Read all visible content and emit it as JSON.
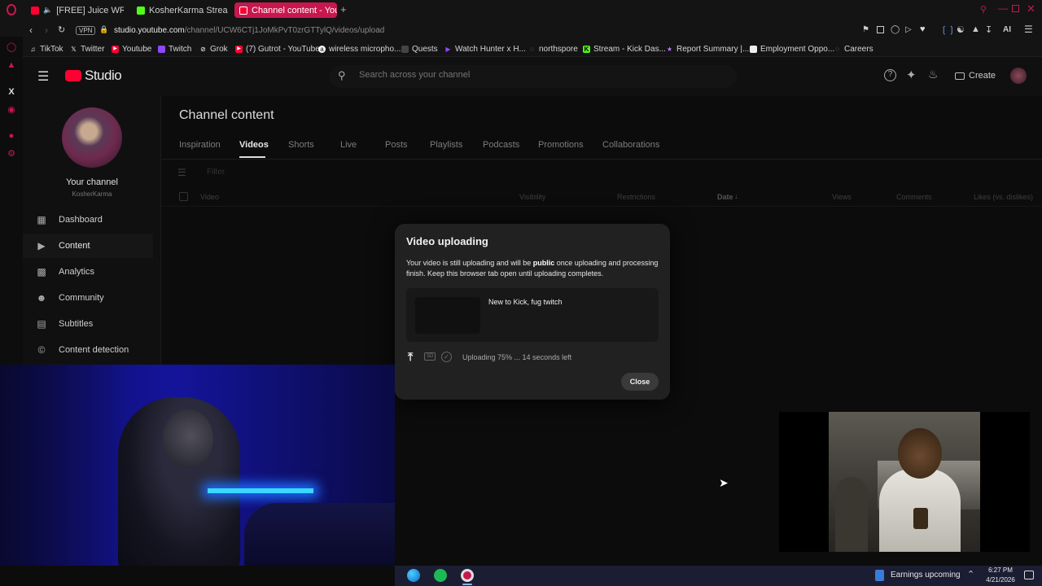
{
  "browser": {
    "tabs": [
      {
        "title": "[FREE] Juice WRLD Ty",
        "color": "#ff0033"
      },
      {
        "title": "KosherKarma Stream - W",
        "color": "#53fc18"
      },
      {
        "title": "Channel content - YouTube",
        "color": "#ff0033",
        "active": true
      }
    ],
    "vpn_label": "VPN",
    "url_domain": "studio.youtube.com",
    "url_path": "/channel/UCW6CTj1JoMkPvT0zrGTTylQ/videos/upload",
    "ai_label": "AI",
    "bookmarks": [
      {
        "label": "TikTok",
        "icon": "tiktok-icon"
      },
      {
        "label": "Twitter",
        "icon": "x-icon"
      },
      {
        "label": "Youtube",
        "icon": "youtube-icon"
      },
      {
        "label": "Twitch",
        "icon": "twitch-icon"
      },
      {
        "label": "Grok",
        "icon": "grok-icon"
      },
      {
        "label": "(7) Gutrot - YouTube",
        "icon": "youtube-icon"
      },
      {
        "label": "wireless micropho...",
        "icon": "amazon-icon"
      },
      {
        "label": "Quests",
        "icon": "quests-icon"
      },
      {
        "label": "Watch Hunter x H...",
        "icon": "play-icon"
      },
      {
        "label": "northspore",
        "icon": "globe-icon"
      },
      {
        "label": "Stream - Kick Das...",
        "icon": "kick-icon"
      },
      {
        "label": "Report Summary |...",
        "icon": "report-icon"
      },
      {
        "label": "Employment Oppo...",
        "icon": "doc-icon"
      },
      {
        "label": "Careers",
        "icon": "globe-icon"
      }
    ]
  },
  "studio": {
    "logo_text": "Studio",
    "search_placeholder": "Search across your channel",
    "create_label": "Create",
    "channel_label": "Your channel",
    "channel_name": "KosherKarma",
    "nav": [
      {
        "label": "Dashboard",
        "icon": "dashboard-icon"
      },
      {
        "label": "Content",
        "icon": "content-icon",
        "active": true
      },
      {
        "label": "Analytics",
        "icon": "analytics-icon"
      },
      {
        "label": "Community",
        "icon": "community-icon"
      },
      {
        "label": "Subtitles",
        "icon": "subtitles-icon"
      },
      {
        "label": "Content detection",
        "icon": "copyright-icon"
      }
    ],
    "page_title": "Channel content",
    "content_tabs": [
      "Inspiration",
      "Videos",
      "Shorts",
      "Live",
      "Posts",
      "Playlists",
      "Podcasts",
      "Promotions",
      "Collaborations"
    ],
    "active_tab": "Videos",
    "filter_placeholder": "Filter",
    "columns": [
      "Video",
      "Visibility",
      "Restrictions",
      "Date",
      "Views",
      "Comments",
      "Likes (vs. dislikes)"
    ]
  },
  "modal": {
    "title": "Video uploading",
    "body_pre": "Your video is still uploading and will be ",
    "body_bold": "public",
    "body_post": " once uploading and processing finish. Keep this browser tab open until uploading completes.",
    "video_title": "New to Kick, fug twitch",
    "sd_badge": "SD",
    "status": "Uploading 75% ... 14 seconds left",
    "progress_percent": 75,
    "close_label": "Close"
  },
  "taskbar": {
    "notification": "Earnings upcoming",
    "time": "6:27 PM",
    "date": "4/21/2026"
  },
  "colors": {
    "accent": "#c8174e",
    "youtube_red": "#ff0033",
    "kick_green": "#53fc18"
  }
}
